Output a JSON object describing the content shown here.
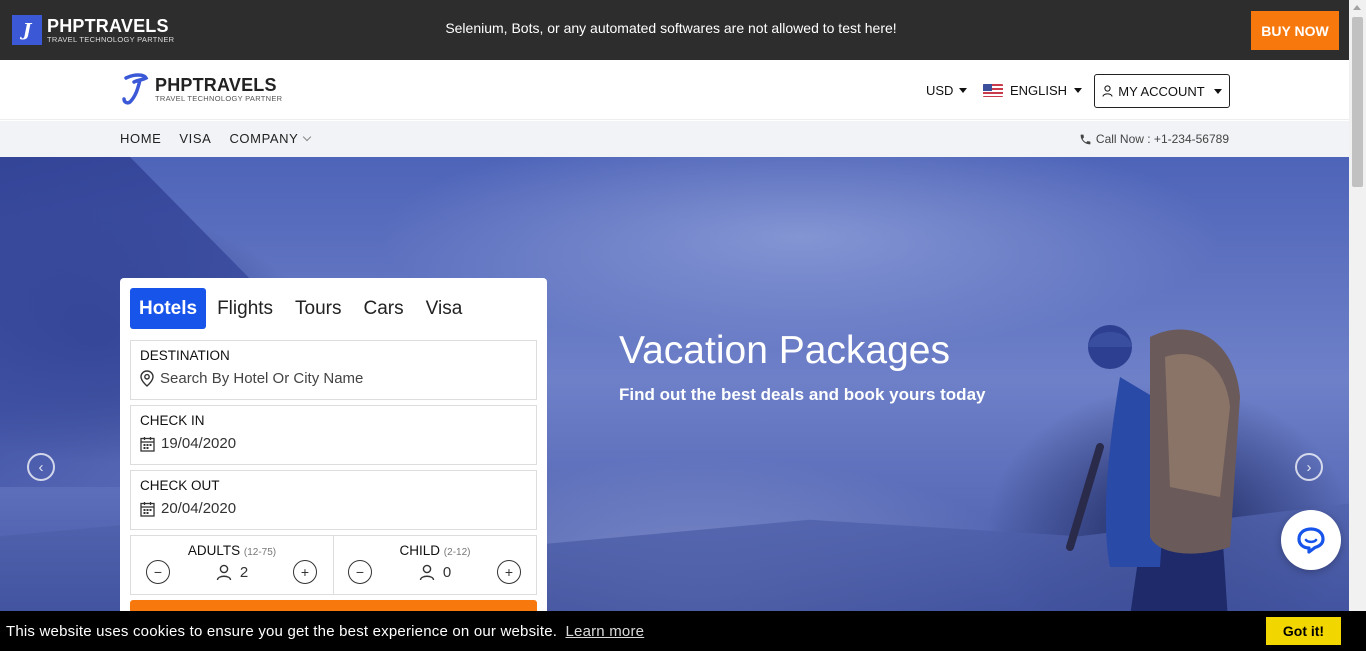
{
  "topbar": {
    "brand": "PHPTRAVELS",
    "tagline": "TRAVEL TECHNOLOGY PARTNER",
    "notice": "Selenium, Bots, or any automated softwares are not allowed to test here!",
    "buy_now": "BUY NOW"
  },
  "header": {
    "brand": "PHPTRAVELS",
    "tagline": "TRAVEL TECHNOLOGY PARTNER",
    "currency": "USD",
    "language": "ENGLISH",
    "account": "MY ACCOUNT"
  },
  "nav": {
    "items": [
      {
        "label": "HOME"
      },
      {
        "label": "VISA"
      },
      {
        "label": "COMPANY"
      }
    ],
    "call": "Call Now : +1-234-56789"
  },
  "hero": {
    "title": "Vacation Packages",
    "subtitle": "Find out the best deals and book yours today"
  },
  "search": {
    "tabs": [
      "Hotels",
      "Flights",
      "Tours",
      "Cars",
      "Visa"
    ],
    "active_tab": "Hotels",
    "destination": {
      "label": "DESTINATION",
      "placeholder": "Search By Hotel Or City Name"
    },
    "checkin": {
      "label": "CHECK IN",
      "value": "19/04/2020"
    },
    "checkout": {
      "label": "CHECK OUT",
      "value": "20/04/2020"
    },
    "adults": {
      "label": "ADULTS",
      "range": "(12-75)",
      "value": "2"
    },
    "child": {
      "label": "CHILD",
      "range": "(2-12)",
      "value": "0"
    },
    "minus": "−",
    "plus": "+"
  },
  "cookie": {
    "message": "This website uses cookies to ensure you get the best experience on our website.",
    "learn_more": "Learn more",
    "got_it": "Got it!"
  },
  "colors": {
    "accent": "#f7790e",
    "primary": "#1654ea",
    "topbar": "#2d2d2d",
    "cookie_button": "#f1d600"
  }
}
